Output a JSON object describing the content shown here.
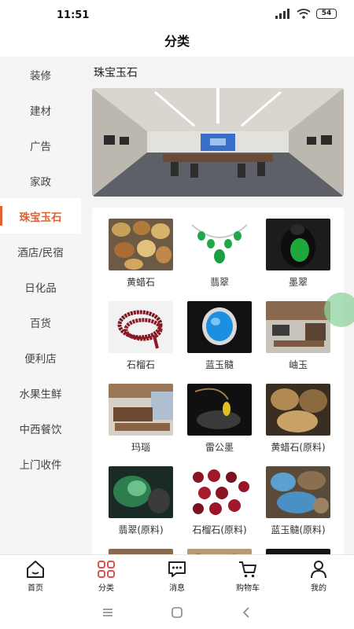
{
  "status": {
    "time": "11:51",
    "battery": "54"
  },
  "header": {
    "title": "分类"
  },
  "sidebar": {
    "items": [
      {
        "label": "装修"
      },
      {
        "label": "建材"
      },
      {
        "label": "广告"
      },
      {
        "label": "家政"
      },
      {
        "label": "珠宝玉石",
        "active": true
      },
      {
        "label": "酒店/民宿"
      },
      {
        "label": "日化品"
      },
      {
        "label": "百货"
      },
      {
        "label": "便利店"
      },
      {
        "label": "水果生鲜"
      },
      {
        "label": "中西餐饮"
      },
      {
        "label": "上门收件"
      }
    ]
  },
  "main": {
    "section_title": "珠宝玉石",
    "items": [
      {
        "label": "黄蜡石"
      },
      {
        "label": "翡翠"
      },
      {
        "label": "墨翠"
      },
      {
        "label": "石榴石"
      },
      {
        "label": "蓝玉髓"
      },
      {
        "label": "岫玉"
      },
      {
        "label": "玛瑙"
      },
      {
        "label": "雷公墨"
      },
      {
        "label": "黄蜡石(原料)"
      },
      {
        "label": "翡翠(原料)"
      },
      {
        "label": "石榴石(原料)"
      },
      {
        "label": "蓝玉髓(原料)"
      }
    ]
  },
  "tabbar": {
    "items": [
      {
        "label": "首页",
        "icon": "home-icon"
      },
      {
        "label": "分类",
        "icon": "category-icon",
        "active": true
      },
      {
        "label": "消息",
        "icon": "message-icon"
      },
      {
        "label": "购物车",
        "icon": "cart-icon"
      },
      {
        "label": "我的",
        "icon": "profile-icon"
      }
    ]
  },
  "colors": {
    "accent": "#e0622e",
    "category_icon": "#d9534f"
  }
}
